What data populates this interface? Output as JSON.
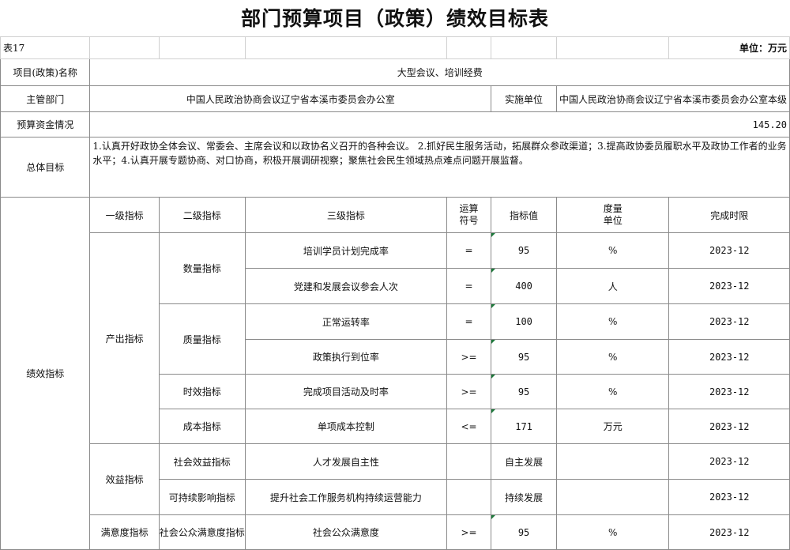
{
  "title": "部门预算项目（政策）绩效目标表",
  "meta": {
    "table_no": "表17",
    "unit": "单位：万元"
  },
  "project": {
    "name_label": "项目(政策)名称",
    "name_value": "大型会议、培训经费",
    "dept_label": "主管部门",
    "dept_value": "中国人民政治协商会议辽宁省本溪市委员会办公室",
    "impl_label": "实施单位",
    "impl_value": "中国人民政治协商会议辽宁省本溪市委员会办公室本级",
    "fund_label": "预算资金情况",
    "fund_value": "145.20",
    "goal_label": "总体目标",
    "goal_value": "1.认真开好政协全体会议、常委会、主席会议和以政协名义召开的各种会议。 2.抓好民生服务活动，拓展群众参政渠道；3.提高政协委员履职水平及政协工作者的业务水平；4.认真开展专题协商、对口协商，积极开展调研视察；聚焦社会民生领域热点难点问题开展监督。"
  },
  "indicators": {
    "section_label": "绩效指标",
    "headers": {
      "l1": "一级指标",
      "l2": "二级指标",
      "l3": "三级指标",
      "op_line1": "运算",
      "op_line2": "符号",
      "value": "指标值",
      "unit_line1": "度量",
      "unit_line2": "单位",
      "deadline": "完成时限"
    },
    "groups": {
      "output": "产出指标",
      "quantity": "数量指标",
      "quality": "质量指标",
      "timeliness": "时效指标",
      "cost": "成本指标",
      "benefit": "效益指标",
      "social_benefit": "社会效益指标",
      "sustainable": "可持续影响指标",
      "satisfaction": "满意度指标",
      "public_satisfaction": "社会公众满意度指标"
    },
    "rows": [
      {
        "name": "培训学员计划完成率",
        "op": "=",
        "value": "95",
        "unit": "%",
        "deadline": "2023-12"
      },
      {
        "name": "党建和发展会议参会人次",
        "op": "=",
        "value": "400",
        "unit": "人",
        "deadline": "2023-12"
      },
      {
        "name": "正常运转率",
        "op": "=",
        "value": "100",
        "unit": "%",
        "deadline": "2023-12"
      },
      {
        "name": "政策执行到位率",
        "op": ">=",
        "value": "95",
        "unit": "%",
        "deadline": "2023-12"
      },
      {
        "name": "完成项目活动及时率",
        "op": ">=",
        "value": "95",
        "unit": "%",
        "deadline": "2023-12"
      },
      {
        "name": "单项成本控制",
        "op": "<=",
        "value": "171",
        "unit": "万元",
        "deadline": "2023-12"
      },
      {
        "name": "人才发展自主性",
        "op": "",
        "value": "自主发展",
        "unit": "",
        "deadline": "2023-12"
      },
      {
        "name": "提升社会工作服务机构持续运营能力",
        "op": "",
        "value": "持续发展",
        "unit": "",
        "deadline": "2023-12"
      },
      {
        "name": "社会公众满意度",
        "op": ">=",
        "value": "95",
        "unit": "%",
        "deadline": "2023-12"
      }
    ]
  }
}
